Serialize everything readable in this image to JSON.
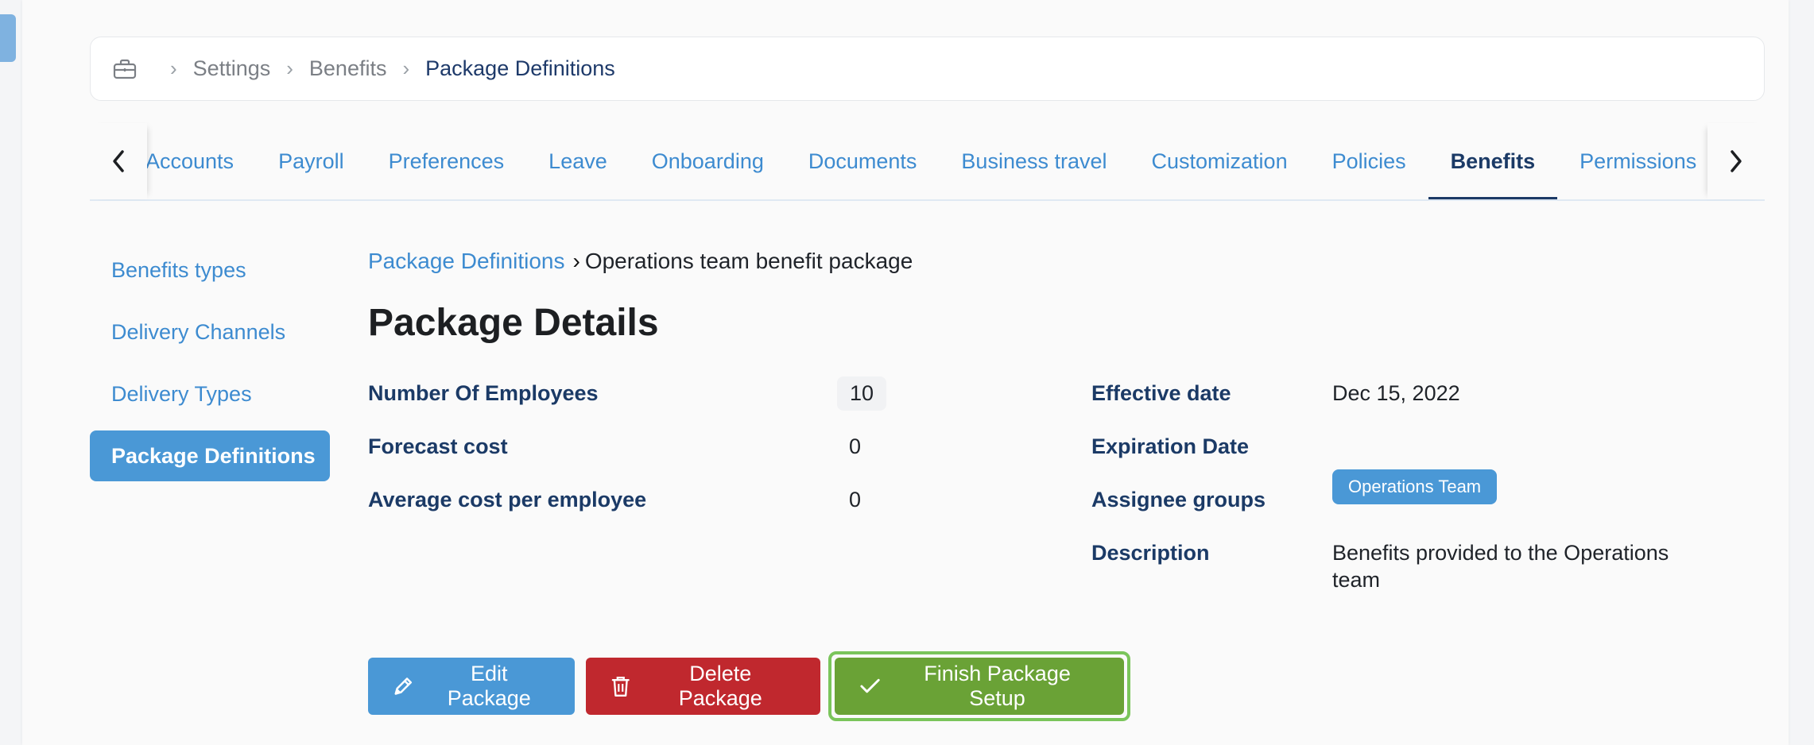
{
  "breadcrumb": {
    "icon": "briefcase-icon",
    "items": [
      "Settings",
      "Benefits"
    ],
    "current": "Package Definitions"
  },
  "tabs": [
    {
      "label": "Accounts"
    },
    {
      "label": "Payroll"
    },
    {
      "label": "Preferences"
    },
    {
      "label": "Leave"
    },
    {
      "label": "Onboarding"
    },
    {
      "label": "Documents"
    },
    {
      "label": "Business travel"
    },
    {
      "label": "Customization"
    },
    {
      "label": "Policies"
    },
    {
      "label": "Benefits",
      "active": true
    },
    {
      "label": "Permissions"
    }
  ],
  "side_nav": [
    {
      "label": "Benefits types"
    },
    {
      "label": "Delivery Channels"
    },
    {
      "label": "Delivery Types"
    },
    {
      "label": "Package Definitions",
      "active": true
    }
  ],
  "sub_breadcrumb": {
    "parent": "Package Definitions",
    "current": "Operations team benefit package"
  },
  "page_title": "Package Details",
  "details_left": [
    {
      "label": "Number Of Employees",
      "value": "10"
    },
    {
      "label": "Forecast cost",
      "value": "0"
    },
    {
      "label": "Average cost per employee",
      "value": "0"
    }
  ],
  "details_right": {
    "effective_label": "Effective date",
    "effective_value": "Dec 15, 2022",
    "expiration_label": "Expiration Date",
    "expiration_value": "",
    "assignee_label": "Assignee groups",
    "assignee_badge": "Operations Team",
    "description_label": "Description",
    "description_value": "Benefits provided to the Operations team"
  },
  "buttons": {
    "edit": "Edit Package",
    "delete": "Delete Package",
    "finish": "Finish Package Setup"
  },
  "colors": {
    "primary": "#4a98d6",
    "navy": "#1b3a66",
    "danger": "#c0282e",
    "success": "#6aa236",
    "focus_ring": "#7ac55b"
  }
}
